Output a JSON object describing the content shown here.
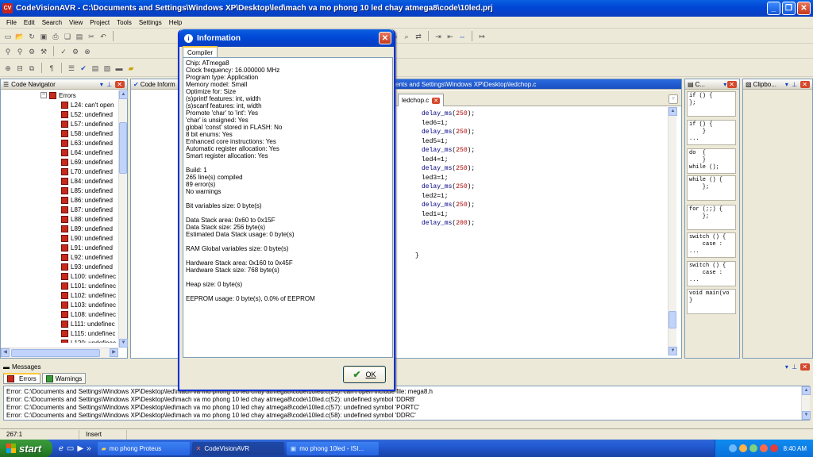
{
  "window": {
    "title": "CodeVisionAVR - C:\\Documents and Settings\\Windows XP\\Desktop\\led\\mach va mo phong 10 led chay atmega8\\code\\10led.prj",
    "icon_label": "CV"
  },
  "menu": [
    "File",
    "Edit",
    "Search",
    "View",
    "Project",
    "Tools",
    "Settings",
    "Help"
  ],
  "code_navigator": {
    "title": "Code Navigator",
    "root": "Errors",
    "items": [
      "L24: can't open",
      "L52: undefined",
      "L57: undefined",
      "L58: undefined",
      "L63: undefined",
      "L64: undefined",
      "L69: undefined",
      "L70: undefined",
      "L84: undefined",
      "L85: undefined",
      "L86: undefined",
      "L87: undefined",
      "L88: undefined",
      "L89: undefined",
      "L90: undefined",
      "L91: undefined",
      "L92: undefined",
      "L93: undefined",
      "L100: undefinec",
      "L101: undefinec",
      "L102: undefinec",
      "L103: undefinec",
      "L108: undefinec",
      "L111: undefinec",
      "L115: undefinec",
      "L120: undefinec"
    ]
  },
  "code_info_title": "Code Inform",
  "editor": {
    "path": "ents and Settings\\Windows XP\\Desktop\\ledchop.c",
    "tab": "ledchop.c",
    "lines": [
      {
        "fn": "delay_ms",
        "arg": "250"
      },
      {
        "text": "led6=1;"
      },
      {
        "fn": "delay_ms",
        "arg": "250"
      },
      {
        "text": "led5=1;"
      },
      {
        "fn": "delay_ms",
        "arg": "250"
      },
      {
        "text": "led4=1;"
      },
      {
        "fn": "delay_ms",
        "arg": "250"
      },
      {
        "text": "led3=1;"
      },
      {
        "fn": "delay_ms",
        "arg": "250"
      },
      {
        "text": "led2=1;"
      },
      {
        "fn": "delay_ms",
        "arg": "250"
      },
      {
        "text": "led1=1;"
      },
      {
        "fn": "delay_ms",
        "arg": "200"
      }
    ],
    "closing_brace": "}"
  },
  "templates": {
    "title": "C...",
    "snippets": [
      "if () {\n};",
      "if () {\n    }\n...",
      "do  {\n    }\nwhile ();",
      "while () {\n    };",
      "for (;;) {\n    };",
      "switch () {\n    case :\n...",
      "switch () {\n    case :\n...",
      "void main(vo\n}"
    ]
  },
  "clipboard_title": "Clipbo...",
  "dialog": {
    "title": "Information",
    "tab": "Compiler",
    "lines": [
      "Chip: ATmega8",
      "Clock frequency: 16.000000 MHz",
      "Program type: Application",
      "Memory model: Small",
      "Optimize for: Size",
      "(s)printf features: int, width",
      "(s)scanf features: int, width",
      "Promote 'char' to 'int': Yes",
      "'char' is unsigned: Yes",
      "global 'const' stored in FLASH: No",
      "8 bit enums: Yes",
      "Enhanced core instructions: Yes",
      "Automatic register allocation: Yes",
      "Smart register allocation: Yes",
      "",
      "Build: 1",
      "265 line(s) compiled",
      "89 error(s)",
      "No warnings",
      "",
      "Bit variables size: 0 byte(s)",
      "",
      "Data Stack area: 0x60 to 0x15F",
      "Data Stack size: 256 byte(s)",
      "Estimated Data Stack usage: 0 byte(s)",
      "",
      "RAM Global variables size: 0 byte(s)",
      "",
      "Hardware Stack area: 0x160 to 0x45F",
      "Hardware Stack size: 768 byte(s)",
      "",
      "Heap size: 0 byte(s)",
      "",
      "EEPROM usage: 0 byte(s), 0.0% of EEPROM"
    ],
    "ok_label": "OK"
  },
  "messages": {
    "title": "Messages",
    "tabs": [
      "Errors",
      "Warnings"
    ],
    "lines": [
      "Error: C:\\Documents and Settings\\Windows XP\\Desktop\\led\\mach va mo phong 10 led chay atmega8\\code\\10led.c(24): can't open include file: mega8.h",
      "Error: C:\\Documents and Settings\\Windows XP\\Desktop\\led\\mach va mo phong 10 led chay atmega8\\code\\10led.c(52): undefined symbol 'DDRB'",
      "Error: C:\\Documents and Settings\\Windows XP\\Desktop\\led\\mach va mo phong 10 led chay atmega8\\code\\10led.c(57): undefined symbol 'PORTC'",
      "Error: C:\\Documents and Settings\\Windows XP\\Desktop\\led\\mach va mo phong 10 led chay atmega8\\code\\10led.c(58): undefined symbol 'DDRC'"
    ]
  },
  "status": {
    "position": "267:1",
    "mode": "Insert"
  },
  "taskbar": {
    "start": "start",
    "tasks": [
      "mo phong Proteus",
      "CodeVisionAVR",
      "mo phong 10led - ISI..."
    ],
    "time": "8:40 AM"
  }
}
